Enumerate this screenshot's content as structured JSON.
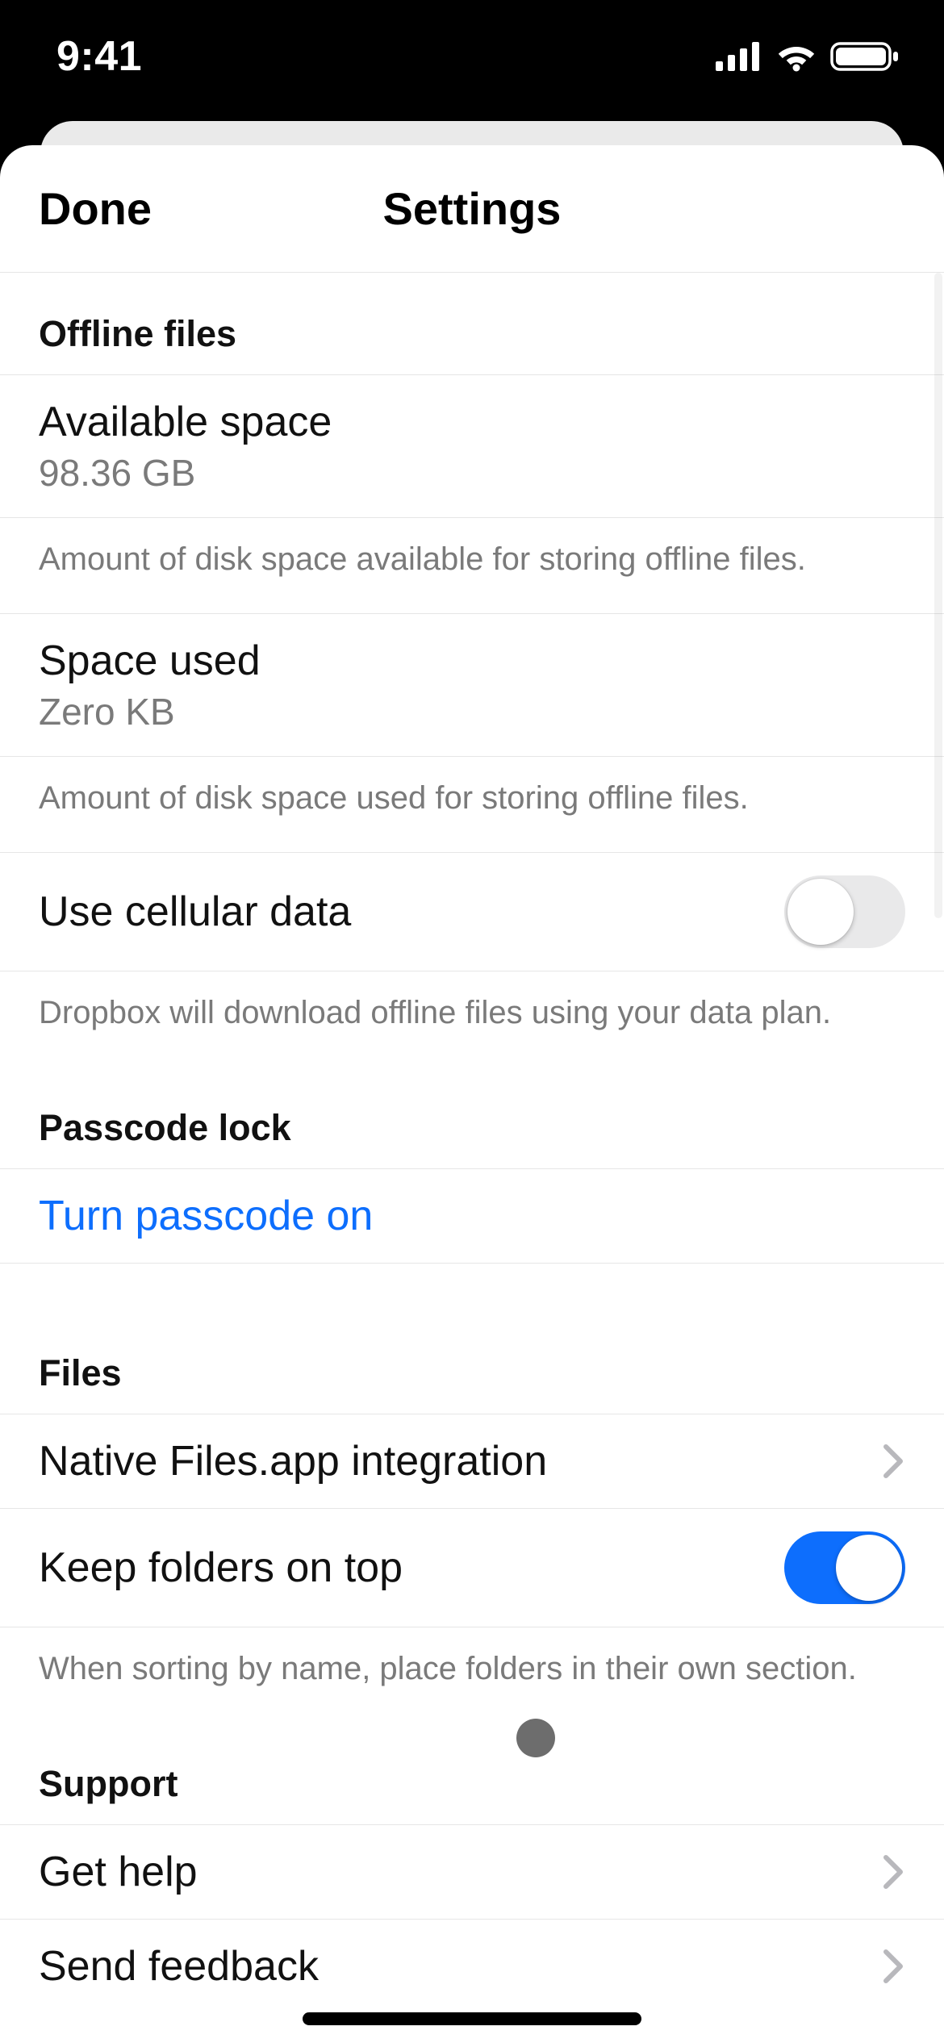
{
  "status": {
    "time": "9:41"
  },
  "nav": {
    "done": "Done",
    "title": "Settings"
  },
  "offline": {
    "header": "Offline files",
    "available_space": {
      "label": "Available space",
      "value": "98.36 GB",
      "footer": "Amount of disk space available for storing offline files."
    },
    "space_used": {
      "label": "Space used",
      "value": "Zero KB",
      "footer": "Amount of disk space used for storing offline files."
    },
    "cellular": {
      "label": "Use cellular data",
      "on": false,
      "footer": "Dropbox will download offline files using your data plan."
    }
  },
  "passcode": {
    "header": "Passcode lock",
    "turn_on": "Turn passcode on"
  },
  "files": {
    "header": "Files",
    "native": "Native Files.app integration",
    "folders_top": {
      "label": "Keep folders on top",
      "on": true,
      "footer": "When sorting by name, place folders in their own section."
    }
  },
  "support": {
    "header": "Support",
    "get_help": "Get help",
    "send_feedback": "Send feedback"
  }
}
